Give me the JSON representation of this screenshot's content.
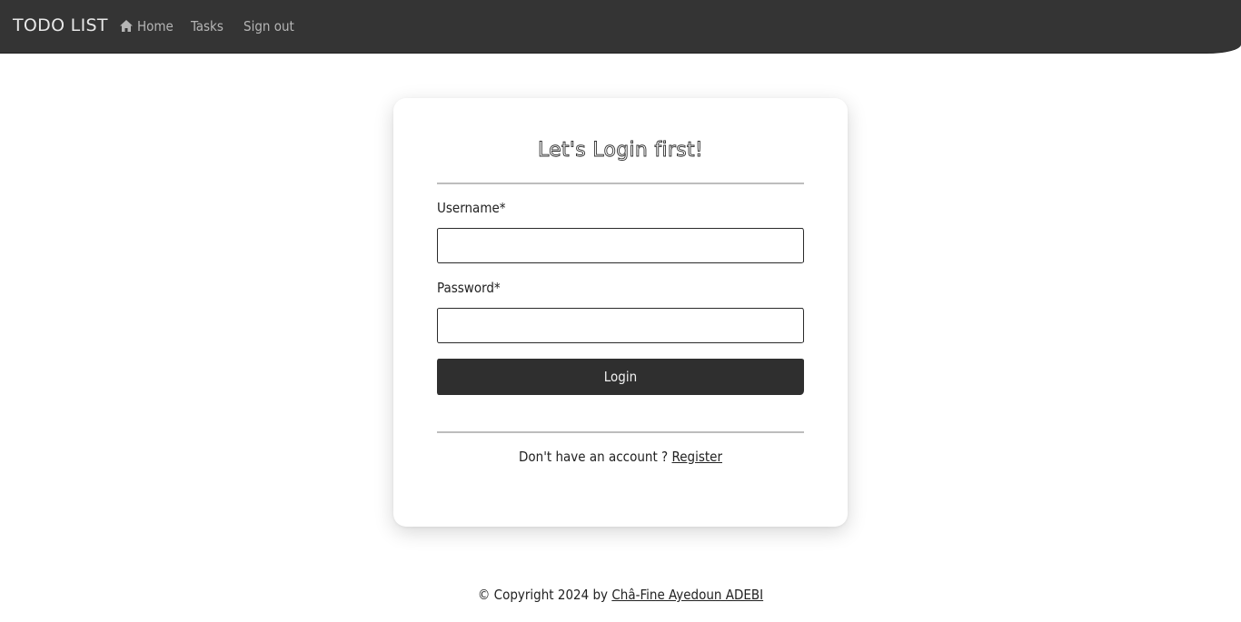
{
  "navbar": {
    "brand": "TODO LIST",
    "links": {
      "home": "Home",
      "tasks": "Tasks",
      "signout": "Sign out"
    },
    "home_icon": "home-icon",
    "background": "#343434"
  },
  "login_card": {
    "title": "Let's Login first!",
    "username_label": "Username*",
    "password_label": "Password*",
    "username_value": "",
    "password_value": "",
    "login_button": "Login",
    "register_prompt": "Don't have an account ?",
    "register_link": "Register"
  },
  "footer": {
    "copyright": "© Copyright 2024 by",
    "author": "Châ-Fine Ayedoun ADEBI"
  }
}
